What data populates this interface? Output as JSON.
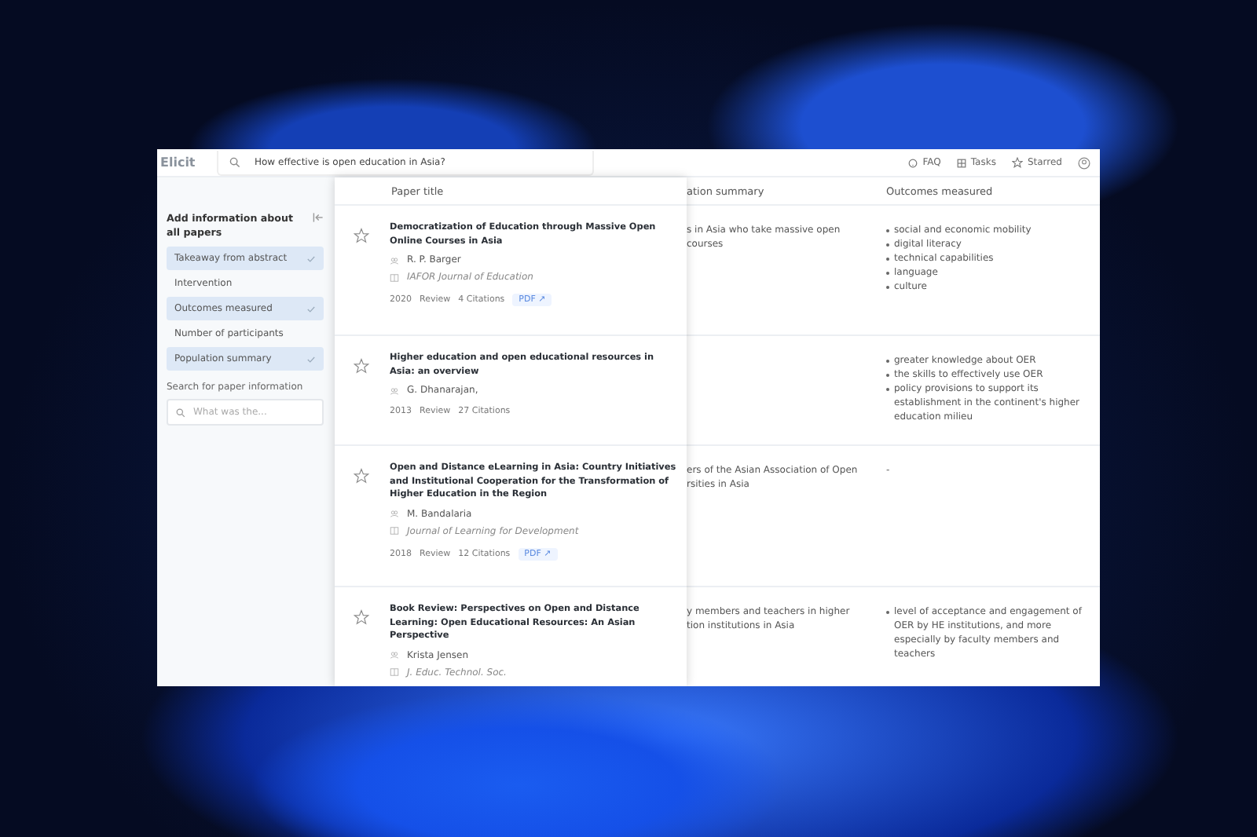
{
  "app": {
    "logo": "Elicit",
    "search": {
      "value": "How effective is open education in Asia?"
    },
    "nav": [
      {
        "kind": "faq",
        "label": "FAQ"
      },
      {
        "kind": "tasks",
        "label": "Tasks"
      },
      {
        "kind": "starred",
        "label": "Starred"
      }
    ]
  },
  "sidebar": {
    "title": "Add information about all papers",
    "items": [
      {
        "label": "Takeaway from abstract",
        "selected": true
      },
      {
        "label": "Intervention",
        "selected": false
      },
      {
        "label": "Outcomes measured",
        "selected": true
      },
      {
        "label": "Number of participants",
        "selected": false
      },
      {
        "label": "Population summary",
        "selected": true
      }
    ],
    "search_label": "Search for paper information",
    "search": {
      "placeholder": "What was the..."
    }
  },
  "table": {
    "columns": [
      "Paper title",
      "ation summary",
      "Outcomes measured"
    ],
    "rows": [
      {
        "paper": {
          "title": "Democratization of Education through Massive Open Online Courses in Asia",
          "starred": false,
          "authors": "R. P. Barger",
          "journal": "IAFOR Journal of Education",
          "year": "2020",
          "type": "Review",
          "citations": "4 Citations",
          "pdf": "PDF ↗"
        },
        "population": [
          "s in Asia who take massive open",
          "courses"
        ],
        "outcomes": [
          "social and economic mobility",
          "digital literacy",
          "technical capabilities",
          "language",
          "culture"
        ]
      },
      {
        "paper": {
          "title": "Higher education and open educational resources in Asia: an overview",
          "starred": false,
          "authors": "G. Dhanarajan,",
          "year": "2013",
          "type": "Review",
          "citations": "27 Citations"
        },
        "population": [],
        "outcomes": [
          "greater knowledge about OER",
          "the skills to effectively use OER",
          "policy provisions to support its establishment in the continent's higher education milieu"
        ]
      },
      {
        "paper": {
          "title": "Open and Distance eLearning in Asia: Country Initiatives and Institutional Cooperation for the Transformation of Higher Education in the Region",
          "starred": false,
          "authors": "M. Bandalaria",
          "journal": "Journal of Learning for Development",
          "year": "2018",
          "type": "Review",
          "citations": "12 Citations",
          "pdf": "PDF ↗"
        },
        "population": [
          "ers of the Asian Association of Open",
          "rsities in Asia"
        ],
        "outcomes_text": "-",
        "outcomes": []
      },
      {
        "paper": {
          "title": "Book Review: Perspectives on Open and Distance Learning: Open Educational Resources: An Asian Perspective",
          "starred": false,
          "authors": "Krista Jensen",
          "journal": "J. Educ. Technol. Soc."
        },
        "population": [
          "y members and teachers in higher",
          "tion institutions in Asia"
        ],
        "outcomes": [
          "level of acceptance and engagement of OER by HE institutions, and more especially by faculty members and teachers"
        ]
      }
    ]
  }
}
